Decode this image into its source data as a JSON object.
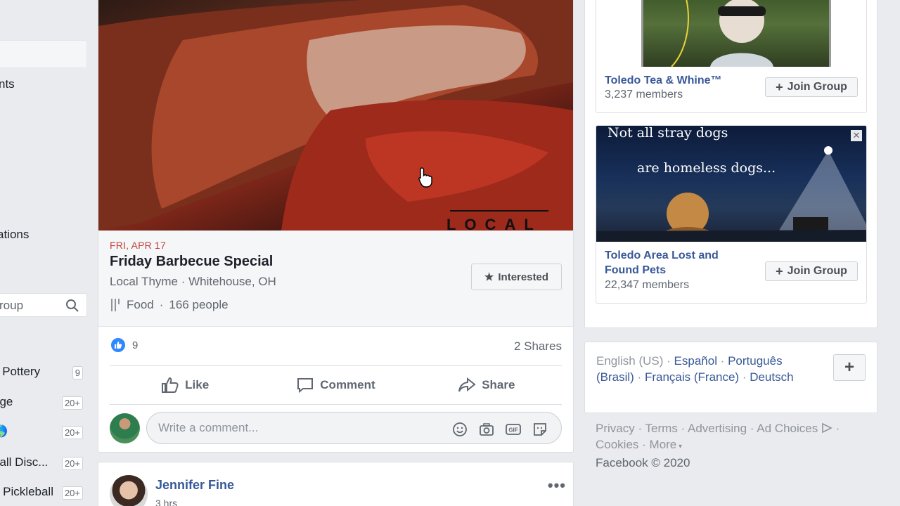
{
  "left_sidebar": {
    "partial_items": [
      "nts",
      "ations"
    ],
    "search_placeholder": "roup",
    "groups": [
      {
        "label": "s Pottery",
        "badge": "9"
      },
      {
        "label": "age",
        "badge": "20+"
      },
      {
        "label": "🌎",
        "badge": "20+"
      },
      {
        "label": "ball Disc...",
        "badge": "20+"
      },
      {
        "label": "d Pickleball",
        "badge": "20+"
      }
    ]
  },
  "event_post": {
    "hero_caption": "LOCAL",
    "date": "FRI, APR 17",
    "title": "Friday Barbecue Special",
    "place": "Local Thyme · Whitehouse, OH",
    "category": "Food",
    "people": "166 people",
    "interested_label": "Interested",
    "like_count": "9",
    "shares": "2 Shares",
    "actions": {
      "like": "Like",
      "comment": "Comment",
      "share": "Share"
    },
    "comment_placeholder": "Write a comment..."
  },
  "next_post": {
    "author": "Jennifer Fine",
    "time": "3 hrs",
    "more": "•••"
  },
  "suggested_groups": [
    {
      "name": "Toledo Tea & Whine™",
      "members": "3,237 members",
      "join_label": "Join Group"
    },
    {
      "name": "Toledo Area Lost and Found Pets",
      "members": "22,347 members",
      "join_label": "Join Group",
      "image_text_line1": "Not all stray dogs",
      "image_text_line2": "are homeless dogs..."
    }
  ],
  "languages": {
    "current": "English (US)",
    "others": [
      "Español",
      "Português (Brasil)",
      "Français (France)",
      "Deutsch"
    ],
    "add_label": "+"
  },
  "footer": {
    "links": [
      "Privacy",
      "Terms",
      "Advertising",
      "Ad Choices",
      "Cookies",
      "More"
    ],
    "copyright": "Facebook © 2020"
  }
}
